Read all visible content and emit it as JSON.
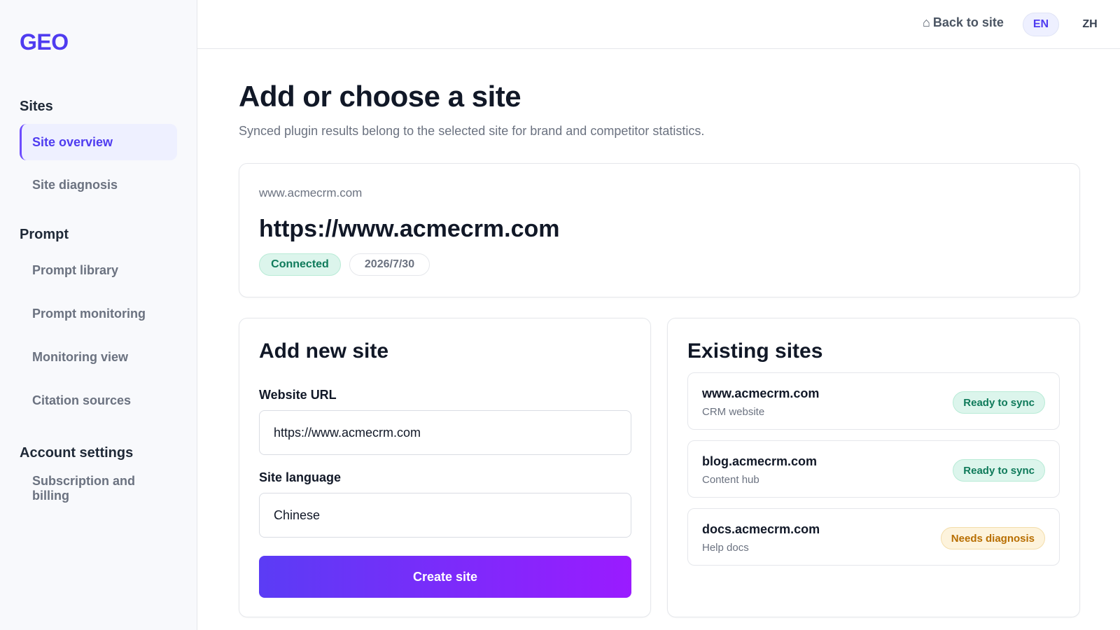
{
  "sidebar": {
    "logo": "GEO",
    "sections": {
      "sites": "Sites",
      "prompt": "Prompt",
      "account": "Account settings"
    },
    "items": {
      "site_overview": "Site overview",
      "site_diagnosis": "Site diagnosis",
      "prompt_library": "Prompt library",
      "prompt_monitoring": "Prompt monitoring",
      "monitoring_view": "Monitoring view",
      "citation_sources": "Citation sources",
      "subscription": "Subscription and billing"
    }
  },
  "topbar": {
    "back_icon": "⌂",
    "back_label": "Back to site",
    "lang_en": "EN",
    "lang_zh": "ZH"
  },
  "main": {
    "title": "Add or choose a site",
    "subtitle": "Synced plugin results belong to the selected site for brand and competitor statistics.",
    "current_site": {
      "domain": "www.acmecrm.com",
      "url": "https://www.acmecrm.com",
      "status": "Connected",
      "date": "2026/7/30"
    },
    "add_site": {
      "title": "Add new site",
      "url_label": "Website URL",
      "url_value": "https://www.acmecrm.com",
      "language_label": "Site language",
      "language_value": "Chinese",
      "create_label": "Create site"
    },
    "existing": {
      "title": "Existing sites",
      "sites": [
        {
          "name": "www.acmecrm.com",
          "desc": "CRM website",
          "status": "Ready to sync"
        },
        {
          "name": "blog.acmecrm.com",
          "desc": "Content hub",
          "status": "Ready to sync"
        },
        {
          "name": "docs.acmecrm.com",
          "desc": "Help docs",
          "status": "Needs diagnosis"
        }
      ]
    }
  },
  "colors": {
    "accent": "#4f3cf0",
    "button_gradient_start": "#5b3cf5",
    "button_gradient_end": "#9a1bff",
    "status_ready": "#0f7a5a",
    "status_needs": "#b86e00"
  }
}
